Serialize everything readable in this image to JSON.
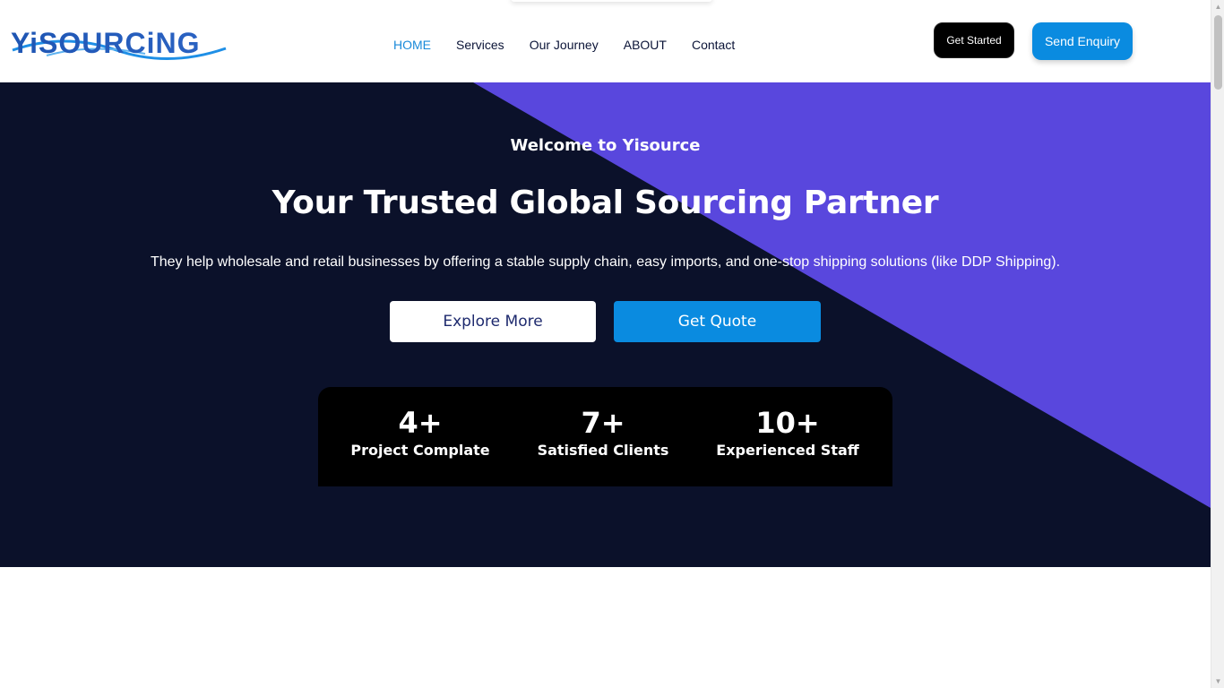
{
  "brand": {
    "logo_text": "YiSOURCiNG",
    "colors": {
      "blue": "#1e55b3",
      "accent_blue": "#0a8be0",
      "navy": "#0b112a",
      "purple": "#5947dd"
    }
  },
  "nav": {
    "items": [
      {
        "label": "HOME",
        "active": true
      },
      {
        "label": "Services",
        "active": false
      },
      {
        "label": "Our Journey",
        "active": false
      },
      {
        "label": "ABOUT",
        "active": false
      },
      {
        "label": "Contact",
        "active": false
      }
    ]
  },
  "header_buttons": {
    "get_started": "Get Started",
    "send_enquiry": "Send Enquiry"
  },
  "hero": {
    "welcome": "Welcome to Yisource",
    "headline": "Your Trusted Global Sourcing Partner",
    "subtext": "They help wholesale and retail businesses by offering a stable supply chain, easy imports, and one-stop shipping solutions (like DDP Shipping).",
    "explore_label": "Explore More",
    "quote_label": "Get Quote"
  },
  "stats": [
    {
      "value": "4+",
      "label": "Project Complate"
    },
    {
      "value": "7+",
      "label": "Satisfied Clients"
    },
    {
      "value": "10+",
      "label": "Experienced Staff"
    }
  ],
  "scrollbar": {
    "up_icon": "triangle-up-icon",
    "down_icon": "triangle-down-icon"
  }
}
